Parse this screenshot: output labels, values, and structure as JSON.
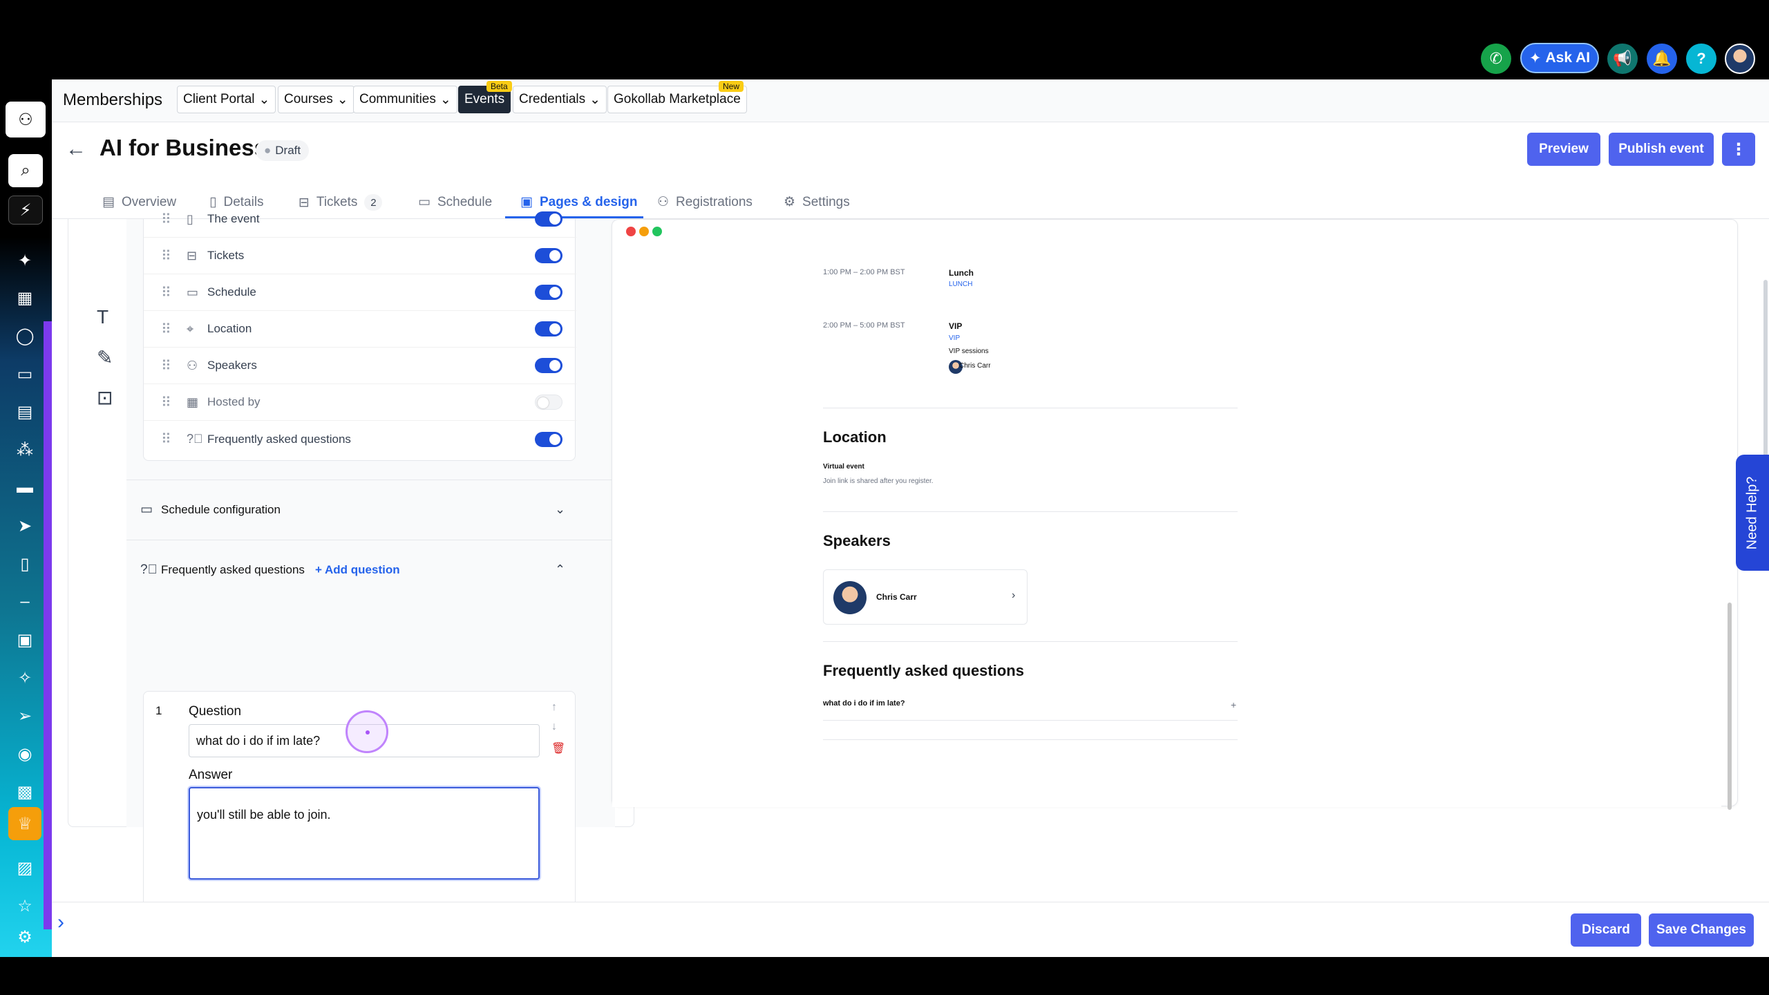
{
  "topbar": {
    "ask_ai_label": "Ask AI",
    "icons": [
      "phone-icon",
      "sparkle-icon",
      "megaphone-icon",
      "bell-icon",
      "help-icon"
    ],
    "help_glyph": "?"
  },
  "subnav": {
    "brand": "Memberships",
    "items": [
      {
        "label": "Client Portal",
        "dropdown": true
      },
      {
        "label": "Courses",
        "dropdown": true
      },
      {
        "label": "Communities",
        "dropdown": true
      },
      {
        "label": "Events",
        "tag": "Beta",
        "active": true
      },
      {
        "label": "Credentials",
        "dropdown": true
      },
      {
        "label": "Gokollab Marketplace",
        "tag": "New"
      }
    ]
  },
  "header": {
    "title": "AI for Business",
    "status": "Draft",
    "preview_label": "Preview",
    "publish_label": "Publish event",
    "more_glyph": "⋮"
  },
  "tabs": [
    {
      "label": "Overview"
    },
    {
      "label": "Details"
    },
    {
      "label": "Tickets",
      "count": "2"
    },
    {
      "label": "Schedule"
    },
    {
      "label": "Pages & design",
      "active": true
    },
    {
      "label": "Registrations"
    },
    {
      "label": "Settings"
    }
  ],
  "sections": [
    {
      "label": "The event",
      "on": true
    },
    {
      "label": "Tickets",
      "on": true
    },
    {
      "label": "Schedule",
      "on": true
    },
    {
      "label": "Location",
      "on": true
    },
    {
      "label": "Speakers",
      "on": true
    },
    {
      "label": "Hosted by",
      "on": false
    },
    {
      "label": "Frequently asked questions",
      "on": true
    }
  ],
  "schedule_config": {
    "label": "Schedule configuration"
  },
  "faq_panel": {
    "label": "Frequently asked questions",
    "add_label": "+ Add question",
    "question_number": "1",
    "question_label": "Question",
    "question_value": "what do i do if im late?",
    "answer_label": "Answer",
    "answer_value": "you'll still be able to join."
  },
  "preview": {
    "sessions": [
      {
        "time": "1:00 PM – 2:00 PM BST",
        "name": "Lunch",
        "tag": "LUNCH"
      },
      {
        "time": "2:00 PM – 5:00 PM BST",
        "name": "VIP",
        "tag": "VIP",
        "desc": "VIP sessions",
        "speaker": "Chris Carr"
      }
    ],
    "location_heading": "Location",
    "location_type": "Virtual event",
    "location_note": "Join link is shared after you register.",
    "speakers_heading": "Speakers",
    "speaker_name": "Chris Carr",
    "faq_heading": "Frequently asked questions",
    "faq_question": "what do i do if im late?",
    "faq_expand": "+",
    "speaker_chevron": "›"
  },
  "need_help_label": "Need Help?",
  "footer": {
    "discard_label": "Discard",
    "save_label": "Save Changes"
  }
}
